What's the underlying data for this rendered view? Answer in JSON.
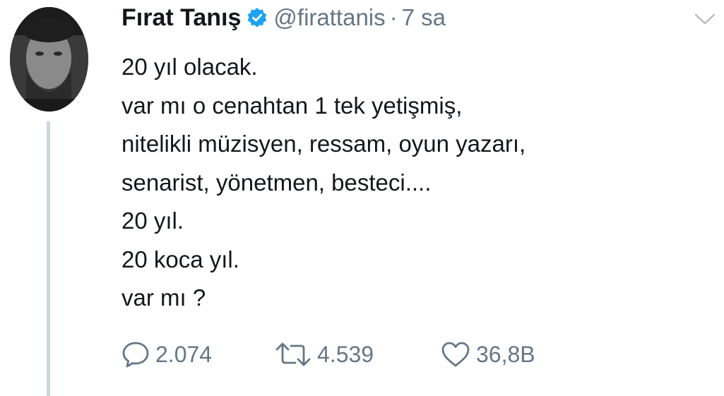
{
  "tweet": {
    "author": {
      "display_name": "Fırat Tanış",
      "handle": "@firattanis",
      "separator": "·",
      "time": "7 sa",
      "verified": true,
      "verified_color": "#1da1f2"
    },
    "lines": [
      "20 yıl olacak.",
      "var mı o cenahtan 1 tek yetişmiş,",
      "nitelikli müzisyen, ressam, oyun yazarı,",
      "senarist, yönetmen, besteci....",
      "20 yıl.",
      "20 koca yıl.",
      "var mı ?"
    ],
    "actions": {
      "reply": {
        "icon": "reply-icon",
        "count": "2.074"
      },
      "retweet": {
        "icon": "retweet-icon",
        "count": "4.539"
      },
      "like": {
        "icon": "heart-icon",
        "count": "36,8B"
      }
    },
    "menu_icon": "chevron-down-icon"
  },
  "colors": {
    "text": "#14171a",
    "muted": "#657786",
    "thread_line": "#ccd6dd",
    "accent": "#1da1f2"
  }
}
